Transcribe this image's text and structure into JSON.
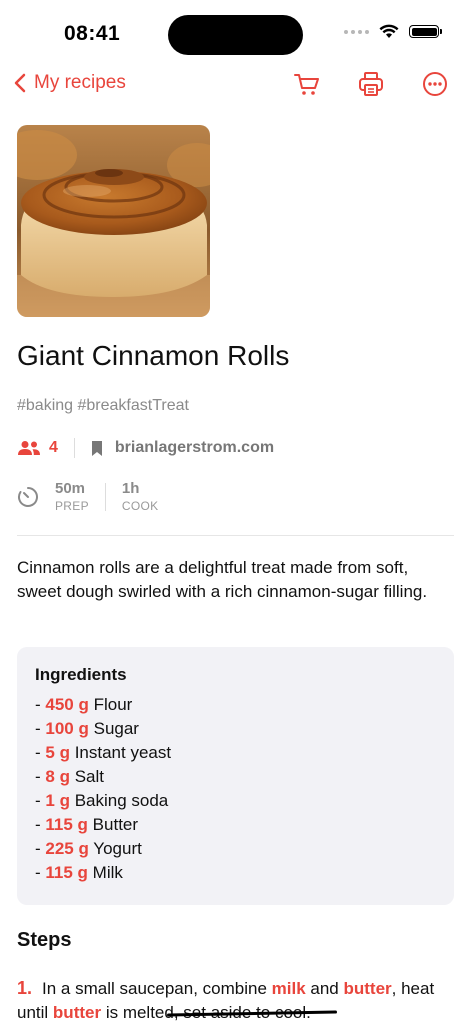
{
  "status": {
    "time": "08:41"
  },
  "nav": {
    "back_label": "My recipes"
  },
  "recipe": {
    "title": "Giant Cinnamon Rolls",
    "tags": "#baking #breakfastTreat",
    "servings": "4",
    "source": "brianlagerstrom.com",
    "prep_value": "50m",
    "prep_label": "PREP",
    "cook_value": "1h",
    "cook_label": "COOK",
    "description": "Cinnamon rolls are a delightful treat made from soft, sweet dough swirled with a rich cinnamon-sugar filling."
  },
  "ingredients": {
    "title": "Ingredients",
    "items": [
      {
        "qty": "450 g",
        "name": "Flour"
      },
      {
        "qty": "100 g",
        "name": "Sugar"
      },
      {
        "qty": "5 g",
        "name": "Instant yeast"
      },
      {
        "qty": "8 g",
        "name": "Salt"
      },
      {
        "qty": "1 g",
        "name": "Baking soda"
      },
      {
        "qty": "115 g",
        "name": "Butter"
      },
      {
        "qty": "225 g",
        "name": "Yogurt"
      },
      {
        "qty": "115 g",
        "name": "Milk"
      }
    ]
  },
  "steps": {
    "title": "Steps",
    "items": [
      {
        "num": "1.",
        "t1": "In a small saucepan, combine ",
        "h1": "milk",
        "t2": " and ",
        "h2": "butter",
        "t3": ", heat until ",
        "h3": "butter",
        "t4": " is melted, set aside to cool."
      }
    ]
  },
  "colors": {
    "accent": "#e8453c",
    "card_bg": "#f2f2f6",
    "muted": "#8a8a8a"
  },
  "icons": {
    "back": "chevron-left-icon",
    "cart": "cart-icon",
    "print": "printer-icon",
    "more": "ellipsis-circle-icon",
    "servings": "people-icon",
    "source": "bookmark-icon",
    "timer": "timer-icon"
  }
}
